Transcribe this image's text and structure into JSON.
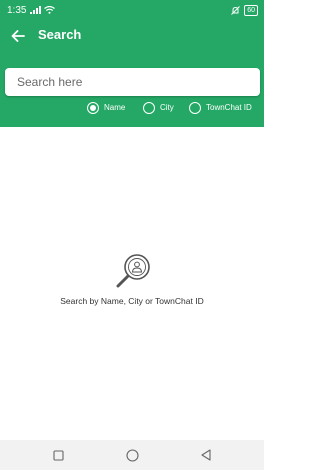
{
  "status_bar": {
    "time": "1:35",
    "battery": "60",
    "icons": [
      "signal-icon",
      "wifi-icon",
      "mute-icon",
      "battery-icon"
    ]
  },
  "app_bar": {
    "title": "Search",
    "back_icon": "arrow-left-icon"
  },
  "search": {
    "placeholder": "Search here",
    "value": ""
  },
  "filter": {
    "selected": "Name",
    "options": [
      "Name",
      "City",
      "TownChat ID"
    ]
  },
  "empty_state": {
    "icon": "search-user-icon",
    "message": "Search by Name, City or TownChat ID"
  },
  "nav_bar": {
    "icons": [
      "recent-apps-icon",
      "home-icon",
      "back-icon"
    ]
  },
  "colors": {
    "primary": "#25a866",
    "background": "#ffffff",
    "nav_background": "#f2f2f2"
  }
}
